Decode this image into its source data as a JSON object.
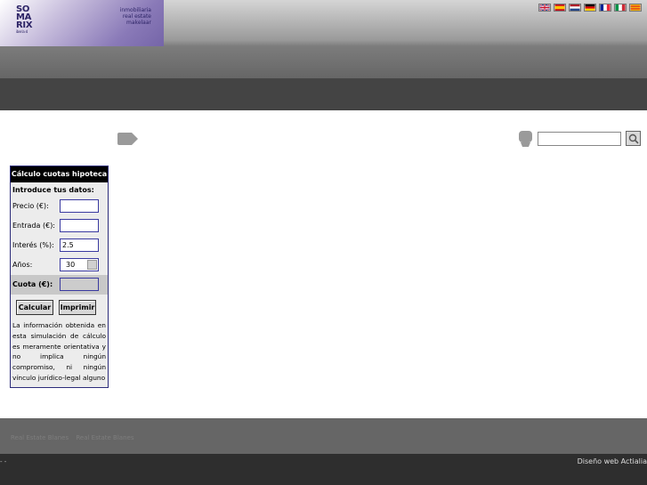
{
  "header": {
    "logo": {
      "mark_lines": [
        "SO",
        "MA",
        "RIX"
      ],
      "mark_sub": "iberia sl",
      "tagline": [
        "inmobiliaria",
        "real estate",
        "makelaar"
      ]
    },
    "languages": [
      {
        "code": "en",
        "icon": "uk-flag-icon"
      },
      {
        "code": "es",
        "icon": "spain-flag-icon"
      },
      {
        "code": "nl",
        "icon": "netherlands-flag-icon"
      },
      {
        "code": "de",
        "icon": "germany-flag-icon"
      },
      {
        "code": "fr",
        "icon": "france-flag-icon"
      },
      {
        "code": "it",
        "icon": "italy-flag-icon"
      },
      {
        "code": "ca",
        "icon": "catalonia-flag-icon"
      }
    ]
  },
  "search": {
    "value": "",
    "placeholder": ""
  },
  "calculator": {
    "title": "Cálculo cuotas hipoteca",
    "subtitle": "Introduce tus datos:",
    "fields": {
      "price_label": "Precio (€):",
      "price_value": "",
      "down_label": "Entrada (€):",
      "down_value": "",
      "interest_label": "Interés (%):",
      "interest_value": "2.5",
      "years_label": "Años:",
      "years_value": "30",
      "fee_label": "Cuota (€):",
      "fee_value": ""
    },
    "buttons": {
      "calculate": "Calcular",
      "print": "Imprimir"
    },
    "note": "La información obtenida en esta simulación de cálculo es meramente orientativa y no implica ningún compromiso, ni ningún vínculo jurídico-legal alguno"
  },
  "footer": {
    "links": [
      "Real Estate Blanes",
      "Real Estate Blanes"
    ],
    "left_text": "- -",
    "credit": "Diseño web Actialia"
  },
  "colors": {
    "header_top": "#d5d5d5",
    "header_bottom": "#666666",
    "navbar": "#444444",
    "logo_purple": "#7565a8",
    "calc_border": "#2c2c7a",
    "footer_gray": "#666666",
    "footer_dark": "#2e2e2e"
  }
}
